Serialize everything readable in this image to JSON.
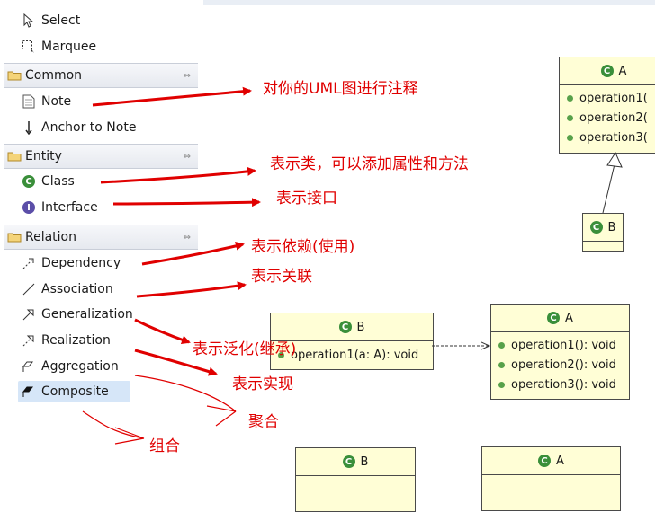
{
  "palette": {
    "tools": [
      {
        "label": "Select",
        "icon": "cursor-icon"
      },
      {
        "label": "Marquee",
        "icon": "marquee-icon"
      }
    ],
    "drawers": [
      {
        "label": "Common",
        "items": [
          {
            "label": "Note",
            "icon": "note-icon"
          },
          {
            "label": "Anchor to Note",
            "icon": "anchor-arrow-icon"
          }
        ]
      },
      {
        "label": "Entity",
        "items": [
          {
            "label": "Class",
            "icon": "class-icon"
          },
          {
            "label": "Interface",
            "icon": "interface-icon"
          }
        ]
      },
      {
        "label": "Relation",
        "items": [
          {
            "label": "Dependency",
            "icon": "dependency-icon"
          },
          {
            "label": "Association",
            "icon": "association-icon"
          },
          {
            "label": "Generalization",
            "icon": "generalization-icon"
          },
          {
            "label": "Realization",
            "icon": "realization-icon"
          },
          {
            "label": "Aggregation",
            "icon": "aggregation-icon"
          },
          {
            "label": "Composite",
            "icon": "composite-icon",
            "selected": true
          }
        ]
      }
    ]
  },
  "annotations": {
    "note": "对你的UML图进行注释",
    "class": "表示类，可以添加属性和方法",
    "interface": "表示接口",
    "dependency": "表示依赖(使用)",
    "association": "表示关联",
    "generalization": "表示泛化(继承)",
    "realization": "表示实现",
    "aggregation": "聚合",
    "composite": "组合"
  },
  "diagram": {
    "class_a_top": {
      "name": "A",
      "icon_letter": "C",
      "ops": [
        "operation1(",
        "operation2(",
        "operation3("
      ]
    },
    "class_b_top": {
      "name": "B",
      "icon_letter": "C"
    },
    "class_b_mid": {
      "name": "B",
      "icon_letter": "C",
      "ops": [
        "operation1(a: A): void"
      ]
    },
    "class_a_mid": {
      "name": "A",
      "icon_letter": "C",
      "ops": [
        "operation1(): void",
        "operation2(): void",
        "operation3(): void"
      ]
    },
    "class_b_bottom": {
      "name": "B",
      "icon_letter": "C"
    },
    "class_a_bottom": {
      "name": "A",
      "icon_letter": "C"
    }
  },
  "colors": {
    "annotation": "#e00000",
    "class_fill": "#fffed6",
    "class_icon": "#3a8f3a"
  }
}
